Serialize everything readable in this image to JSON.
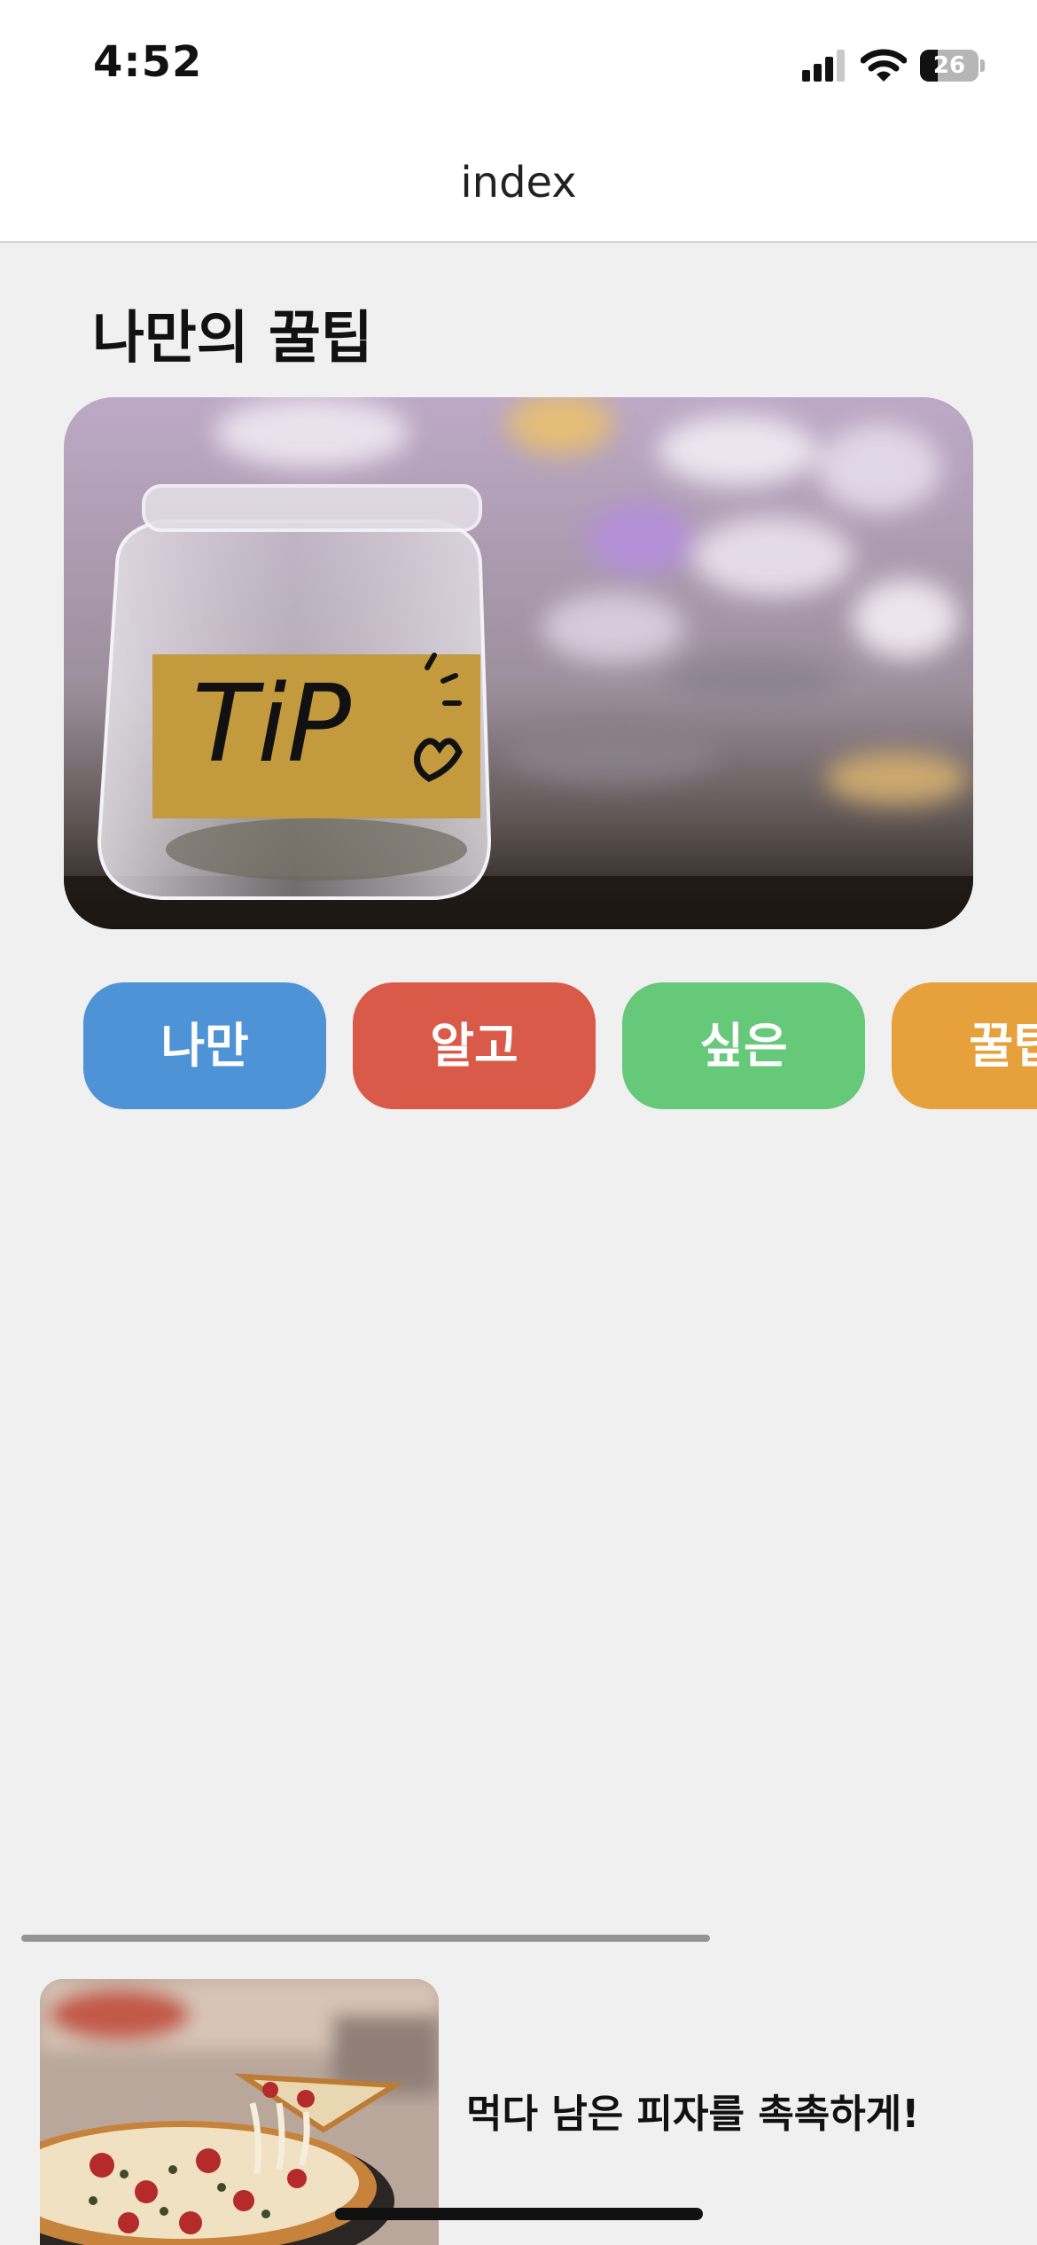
{
  "status_bar": {
    "time": "4:52",
    "battery_level": "26",
    "icons": [
      "signal-icon",
      "wifi-icon",
      "battery-icon"
    ]
  },
  "nav": {
    "title": "index"
  },
  "main": {
    "section_title": "나만의 꿀팁",
    "hero_image": {
      "label": "TiP",
      "icon": "tip-jar-photo"
    },
    "categories": [
      {
        "label": "나만",
        "color": "#4f93d7"
      },
      {
        "label": "알고",
        "color": "#d95a48"
      },
      {
        "label": "싶은",
        "color": "#66c97a"
      },
      {
        "label": "꿀팁",
        "color": "#e6a13d"
      }
    ]
  },
  "list": {
    "items": [
      {
        "title": "먹다 남은 피자를 촉촉하게!",
        "image_icon": "pizza-photo"
      }
    ]
  },
  "colors": {
    "background": "#f1f0f1",
    "nav_background": "#ffffff"
  }
}
